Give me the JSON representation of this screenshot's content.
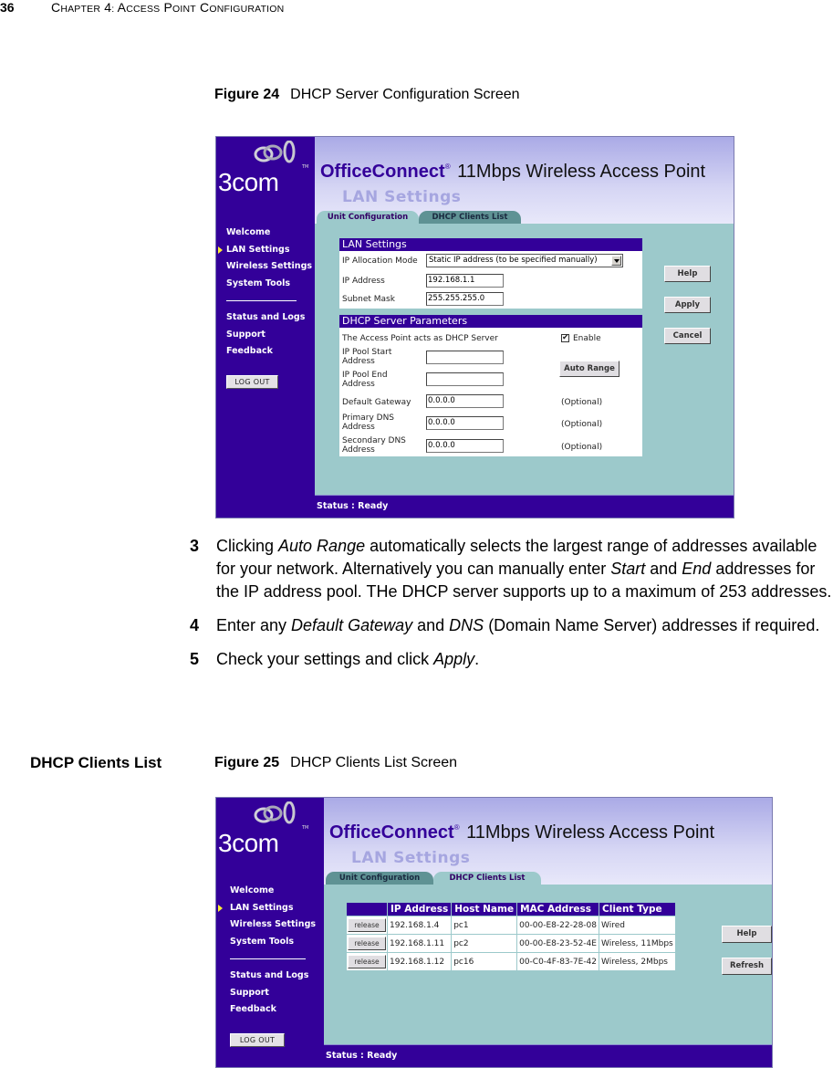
{
  "page_header": {
    "page_number": "36",
    "chapter_title": "CHAPTER 4: ACCESS POINT CONFIGURATION"
  },
  "figure24": {
    "label": "Figure 24",
    "title": "DHCP Server Configuration Screen"
  },
  "figure25": {
    "label": "Figure 25",
    "title": "DHCP Clients List Screen"
  },
  "section_heading": "DHCP Clients List",
  "steps": [
    {
      "num": "3",
      "parts": [
        "Clicking ",
        "Auto Range",
        " automatically selects the largest range of addresses available for your network. Alternatively you can manually enter ",
        "Start",
        " and ",
        "End",
        " addresses for the IP address pool. THe DHCP server supports up to a maximum of 253 addresses."
      ]
    },
    {
      "num": "4",
      "parts": [
        "Enter any ",
        "Default Gateway",
        " and ",
        "DNS",
        " (Domain Name Server) addresses if required."
      ]
    },
    {
      "num": "5",
      "parts": [
        "Check your settings and click ",
        "Apply",
        "."
      ]
    }
  ],
  "ui_common": {
    "logo_text": "3COM",
    "logo_tm": "TM",
    "brand_bold": "OfficeConnect",
    "brand_reg": "®",
    "brand_rest": " 11Mbps Wireless Access Point",
    "page_heading": "LAN Settings",
    "tabs": [
      "Unit Configuration",
      "DHCP Clients List"
    ],
    "nav_primary": [
      "Welcome",
      "LAN Settings",
      "Wireless Settings",
      "System Tools"
    ],
    "nav_secondary": [
      "Status and Logs",
      "Support",
      "Feedback"
    ],
    "active_nav": "LAN Settings",
    "logout_label": "LOG OUT",
    "status_text": "Status : Ready",
    "colors": {
      "sidebar": "#330099",
      "content_bg": "#9cc9cb",
      "active_arrow": "#ffee33",
      "heading": "#a6a6e0"
    }
  },
  "screen1": {
    "active_tab": "Unit Configuration",
    "lan_panel": {
      "title": "LAN Settings",
      "ip_allocation_label": "IP Allocation Mode",
      "ip_allocation_value": "Static IP address (to be specified manually)",
      "ip_address_label": "IP Address",
      "ip_address_value": "192.168.1.1",
      "subnet_label": "Subnet Mask",
      "subnet_value": "255.255.255.0"
    },
    "dhcp_panel": {
      "title": "DHCP Server Parameters",
      "acts_as_label": "The Access Point acts as DHCP Server",
      "enable_label": "Enable",
      "enable_checked": true,
      "pool_start_label_1": "IP Pool Start",
      "pool_start_label_2": "Address",
      "pool_start_value": "",
      "pool_end_label_1": "IP Pool End",
      "pool_end_label_2": "Address",
      "pool_end_value": "",
      "auto_range_label": "Auto Range",
      "gateway_label": "Default Gateway",
      "gateway_value": "0.0.0.0",
      "primary_dns_label_1": "Primary DNS",
      "primary_dns_label_2": "Address",
      "primary_dns_value": "0.0.0.0",
      "secondary_dns_label_1": "Secondary DNS",
      "secondary_dns_label_2": "Address",
      "secondary_dns_value": "0.0.0.0",
      "optional_label": "(Optional)"
    },
    "buttons": {
      "help": "Help",
      "apply": "Apply",
      "cancel": "Cancel"
    }
  },
  "screen2": {
    "active_tab": "DHCP Clients List",
    "table": {
      "columns": [
        "",
        "IP Address",
        "Host Name",
        "MAC Address",
        "Client Type"
      ],
      "release_label": "release",
      "rows": [
        {
          "ip": "192.168.1.4",
          "host": "pc1",
          "mac": "00-00-E8-22-28-08",
          "type": "Wired"
        },
        {
          "ip": "192.168.1.11",
          "host": "pc2",
          "mac": "00-00-E8-23-52-4E",
          "type": "Wireless, 11Mbps"
        },
        {
          "ip": "192.168.1.12",
          "host": "pc16",
          "mac": "00-C0-4F-83-7E-42",
          "type": "Wireless, 2Mbps"
        }
      ]
    },
    "buttons": {
      "help": "Help",
      "refresh": "Refresh"
    }
  }
}
